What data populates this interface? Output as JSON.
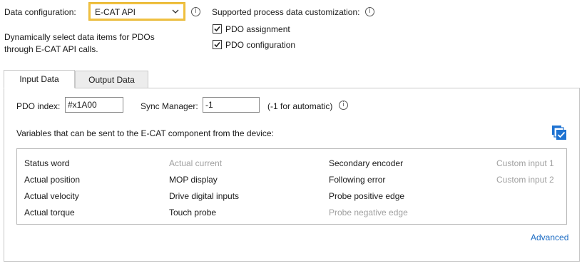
{
  "data_configuration": {
    "label": "Data configuration:",
    "selected": "E-CAT API",
    "description_line1": "Dynamically select data items for PDOs",
    "description_line2": "through E-CAT API calls."
  },
  "customization": {
    "label": "Supported process data customization:",
    "options": [
      {
        "label": "PDO assignment",
        "checked": true
      },
      {
        "label": "PDO configuration",
        "checked": true
      }
    ]
  },
  "tabs": [
    {
      "label": "Input Data",
      "active": true
    },
    {
      "label": "Output Data",
      "active": false
    }
  ],
  "pdo": {
    "index_label": "PDO index:",
    "index_value": "#x1A00",
    "sync_label": "Sync Manager:",
    "sync_value": "-1",
    "sync_hint": "(-1 for automatic)"
  },
  "variables": {
    "heading": "Variables that can be sent to the E-CAT component from the device:",
    "columns": [
      [
        {
          "label": "Status word",
          "enabled": true
        },
        {
          "label": "Actual position",
          "enabled": true
        },
        {
          "label": "Actual velocity",
          "enabled": true
        },
        {
          "label": "Actual torque",
          "enabled": true
        }
      ],
      [
        {
          "label": "Actual current",
          "enabled": false
        },
        {
          "label": "MOP display",
          "enabled": true
        },
        {
          "label": "Drive digital inputs",
          "enabled": true
        },
        {
          "label": "Touch probe",
          "enabled": true
        }
      ],
      [
        {
          "label": "Secondary encoder",
          "enabled": true
        },
        {
          "label": "Following error",
          "enabled": true
        },
        {
          "label": "Probe positive edge",
          "enabled": true
        },
        {
          "label": "Probe negative edge",
          "enabled": false
        }
      ],
      [
        {
          "label": "Custom input 1",
          "enabled": false
        },
        {
          "label": "Custom input 2",
          "enabled": false
        }
      ]
    ]
  },
  "advanced_link": "Advanced",
  "icons": {
    "info": "info-icon",
    "select_all": "copy-check-icon",
    "dropdown": "chevron-down-icon"
  },
  "colors": {
    "select_border": "#f0c040",
    "link": "#1c6cc4",
    "icon_blue": "#1e73d2"
  }
}
